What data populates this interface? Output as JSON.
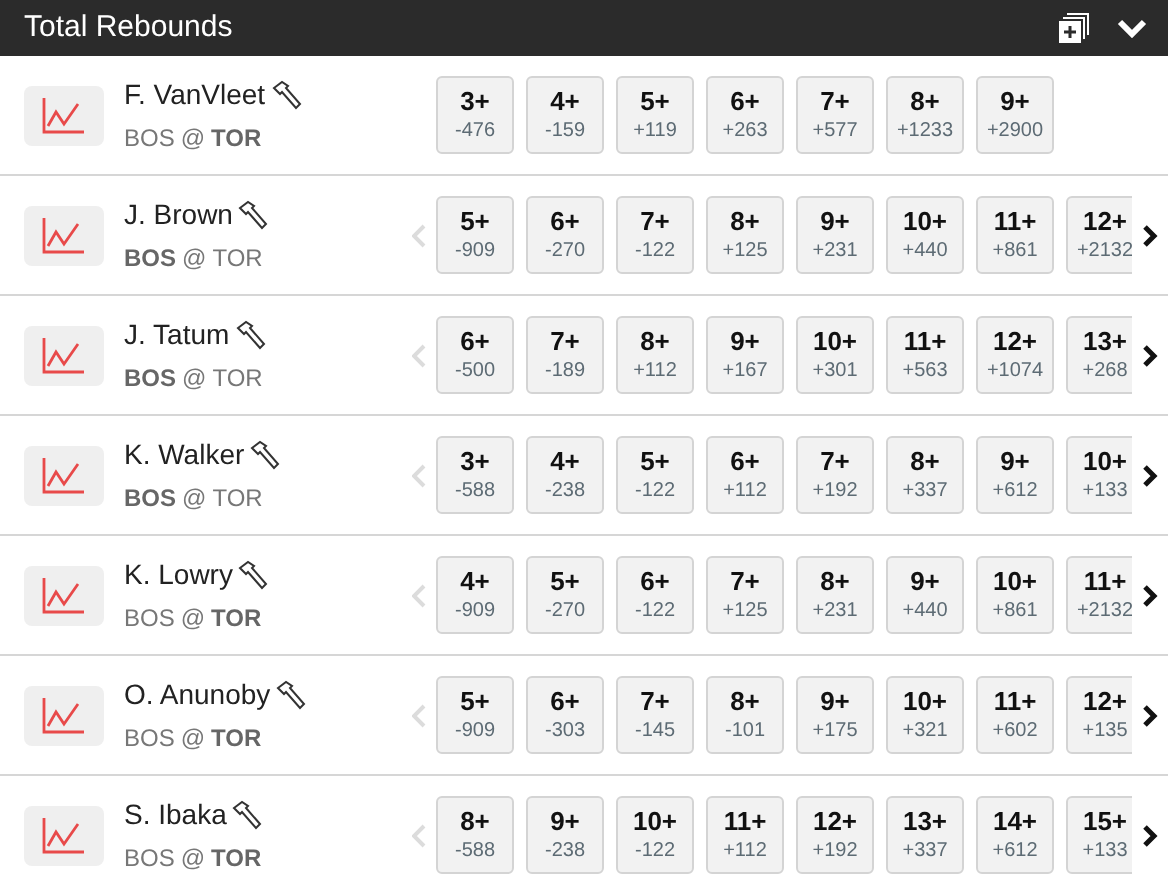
{
  "header": {
    "title": "Total Rebounds"
  },
  "players": [
    {
      "name": "F. VanVleet",
      "teams": [
        {
          "abbr": "BOS",
          "bold": false
        },
        {
          "abbr": "TOR",
          "bold": true
        }
      ],
      "separator": "@",
      "scroll_left": false,
      "scroll_right": false,
      "lines": [
        {
          "line": "3+",
          "odds": "-476"
        },
        {
          "line": "4+",
          "odds": "-159"
        },
        {
          "line": "5+",
          "odds": "+119"
        },
        {
          "line": "6+",
          "odds": "+263"
        },
        {
          "line": "7+",
          "odds": "+577"
        },
        {
          "line": "8+",
          "odds": "+1233"
        },
        {
          "line": "9+",
          "odds": "+2900"
        }
      ]
    },
    {
      "name": "J. Brown",
      "teams": [
        {
          "abbr": "BOS",
          "bold": true
        },
        {
          "abbr": "TOR",
          "bold": false
        }
      ],
      "separator": "@",
      "scroll_left": true,
      "scroll_right": true,
      "lines": [
        {
          "line": "5+",
          "odds": "-909"
        },
        {
          "line": "6+",
          "odds": "-270"
        },
        {
          "line": "7+",
          "odds": "-122"
        },
        {
          "line": "8+",
          "odds": "+125"
        },
        {
          "line": "9+",
          "odds": "+231"
        },
        {
          "line": "10+",
          "odds": "+440"
        },
        {
          "line": "11+",
          "odds": "+861"
        },
        {
          "line": "12+",
          "odds": "+2132"
        }
      ]
    },
    {
      "name": "J. Tatum",
      "teams": [
        {
          "abbr": "BOS",
          "bold": true
        },
        {
          "abbr": "TOR",
          "bold": false
        }
      ],
      "separator": "@",
      "scroll_left": true,
      "scroll_right": true,
      "lines": [
        {
          "line": "6+",
          "odds": "-500"
        },
        {
          "line": "7+",
          "odds": "-189"
        },
        {
          "line": "8+",
          "odds": "+112"
        },
        {
          "line": "9+",
          "odds": "+167"
        },
        {
          "line": "10+",
          "odds": "+301"
        },
        {
          "line": "11+",
          "odds": "+563"
        },
        {
          "line": "12+",
          "odds": "+1074"
        },
        {
          "line": "13+",
          "odds": "+268"
        }
      ]
    },
    {
      "name": "K. Walker",
      "teams": [
        {
          "abbr": "BOS",
          "bold": true
        },
        {
          "abbr": "TOR",
          "bold": false
        }
      ],
      "separator": "@",
      "scroll_left": true,
      "scroll_right": true,
      "lines": [
        {
          "line": "3+",
          "odds": "-588"
        },
        {
          "line": "4+",
          "odds": "-238"
        },
        {
          "line": "5+",
          "odds": "-122"
        },
        {
          "line": "6+",
          "odds": "+112"
        },
        {
          "line": "7+",
          "odds": "+192"
        },
        {
          "line": "8+",
          "odds": "+337"
        },
        {
          "line": "9+",
          "odds": "+612"
        },
        {
          "line": "10+",
          "odds": "+133"
        }
      ]
    },
    {
      "name": "K. Lowry",
      "teams": [
        {
          "abbr": "BOS",
          "bold": false
        },
        {
          "abbr": "TOR",
          "bold": true
        }
      ],
      "separator": "@",
      "scroll_left": true,
      "scroll_right": true,
      "lines": [
        {
          "line": "4+",
          "odds": "-909"
        },
        {
          "line": "5+",
          "odds": "-270"
        },
        {
          "line": "6+",
          "odds": "-122"
        },
        {
          "line": "7+",
          "odds": "+125"
        },
        {
          "line": "8+",
          "odds": "+231"
        },
        {
          "line": "9+",
          "odds": "+440"
        },
        {
          "line": "10+",
          "odds": "+861"
        },
        {
          "line": "11+",
          "odds": "+2132"
        }
      ]
    },
    {
      "name": "O. Anunoby",
      "teams": [
        {
          "abbr": "BOS",
          "bold": false
        },
        {
          "abbr": "TOR",
          "bold": true
        }
      ],
      "separator": "@",
      "scroll_left": true,
      "scroll_right": true,
      "lines": [
        {
          "line": "5+",
          "odds": "-909"
        },
        {
          "line": "6+",
          "odds": "-303"
        },
        {
          "line": "7+",
          "odds": "-145"
        },
        {
          "line": "8+",
          "odds": "-101"
        },
        {
          "line": "9+",
          "odds": "+175"
        },
        {
          "line": "10+",
          "odds": "+321"
        },
        {
          "line": "11+",
          "odds": "+602"
        },
        {
          "line": "12+",
          "odds": "+135"
        }
      ]
    },
    {
      "name": "S. Ibaka",
      "teams": [
        {
          "abbr": "BOS",
          "bold": false
        },
        {
          "abbr": "TOR",
          "bold": true
        }
      ],
      "separator": "@",
      "scroll_left": true,
      "scroll_right": true,
      "lines": [
        {
          "line": "8+",
          "odds": "-588"
        },
        {
          "line": "9+",
          "odds": "-238"
        },
        {
          "line": "10+",
          "odds": "-122"
        },
        {
          "line": "11+",
          "odds": "+112"
        },
        {
          "line": "12+",
          "odds": "+192"
        },
        {
          "line": "13+",
          "odds": "+337"
        },
        {
          "line": "14+",
          "odds": "+612"
        },
        {
          "line": "15+",
          "odds": "+133"
        }
      ]
    }
  ]
}
